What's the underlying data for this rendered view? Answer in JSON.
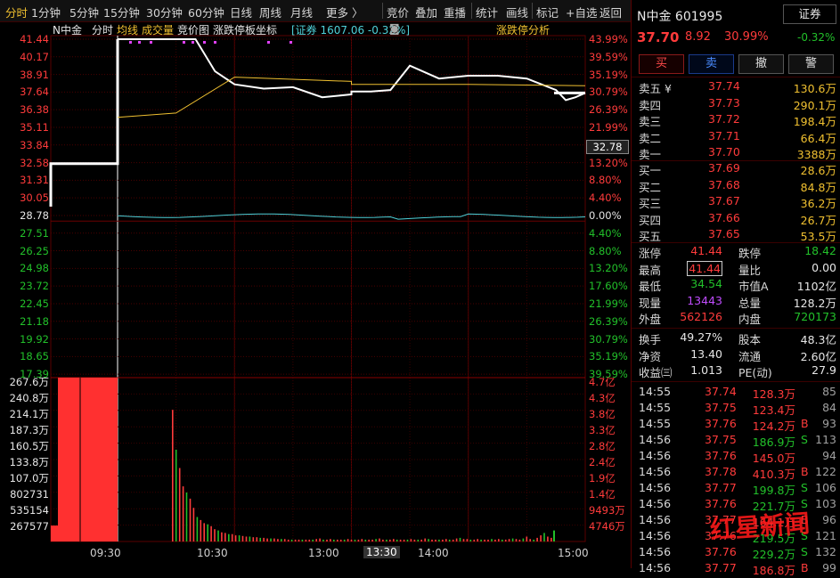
{
  "toolbar": {
    "items": [
      "分时",
      "1分钟",
      "5分钟",
      "15分钟",
      "30分钟",
      "60分钟",
      "日线",
      "周线",
      "月线",
      "更多 〉",
      "竞价",
      "叠加",
      "重播",
      "统计",
      "画线",
      "标记",
      "+自选",
      "返回"
    ]
  },
  "infobar": {
    "name": "N中金",
    "mode": "分时",
    "avg_label": "均线",
    "vol_label": "成交量",
    "auction_label": "竞价图",
    "limit_label": "涨跌停板坐标",
    "index_text": "[证券 1607.06 -0.32%]",
    "analysis_label": "涨跌停分析"
  },
  "price_axis": {
    "left": [
      "41.44",
      "40.17",
      "38.91",
      "37.64",
      "36.38",
      "35.11",
      "33.84",
      "32.58",
      "31.31",
      "30.05",
      "28.78",
      "27.51",
      "26.25",
      "24.98",
      "23.72",
      "22.45",
      "21.18",
      "19.92",
      "18.65",
      "17.39"
    ],
    "right": [
      "43.99%",
      "39.59%",
      "35.19%",
      "30.79%",
      "26.39%",
      "21.99%",
      "17.59%",
      "13.20%",
      "8.80%",
      "4.40%",
      "0.00%",
      "4.40%",
      "8.80%",
      "13.20%",
      "17.60%",
      "21.99%",
      "26.39%",
      "30.79%",
      "35.19%",
      "39.59%"
    ],
    "cursor_price": "32.78"
  },
  "volume_axis": {
    "left": [
      "267.6万",
      "240.8万",
      "214.1万",
      "187.3万",
      "160.5万",
      "133.8万",
      "107.0万",
      "802731",
      "535154",
      "267577"
    ],
    "right": [
      "4.7亿",
      "4.3亿",
      "3.8亿",
      "3.3亿",
      "2.8亿",
      "2.4亿",
      "1.9亿",
      "1.4亿",
      "9493万",
      "4746万"
    ]
  },
  "time_axis": [
    "09:30",
    "10:30",
    "13:00",
    "13:30",
    "14:00",
    "15:00"
  ],
  "chart_data": {
    "type": "line",
    "title": "",
    "xlabel": "",
    "ylabel": "",
    "prev_close": 28.78,
    "ylim": [
      17.39,
      41.44
    ],
    "auction_price": 32.78,
    "series": [
      {
        "x": [
          "09:30",
          "09:31",
          "09:35",
          "09:40",
          "09:45",
          "09:50",
          "09:55",
          "10:00",
          "10:10",
          "10:20",
          "10:30",
          "10:45",
          "11:00",
          "11:15",
          "11:30",
          "13:00",
          "13:10",
          "13:20",
          "13:30",
          "13:45",
          "14:00",
          "14:15",
          "14:30",
          "14:45",
          "14:50",
          "14:55",
          "15:00"
        ],
        "values": [
          41.44,
          41.44,
          41.44,
          41.44,
          41.44,
          41.44,
          41.44,
          41.44,
          41.44,
          39.2,
          38.3,
          38.0,
          38.1,
          37.4,
          37.6,
          37.8,
          37.8,
          37.9,
          39.6,
          38.7,
          38.9,
          38.9,
          38.7,
          37.9,
          37.2,
          37.4,
          37.7
        ]
      },
      {
        "x": [
          "09:30",
          "10:00",
          "10:30",
          "11:30",
          "13:00",
          "14:00",
          "15:00"
        ],
        "values": [
          36.0,
          36.3,
          38.8,
          38.5,
          38.3,
          38.3,
          38.2
        ]
      }
    ],
    "volume": {
      "unit": "万",
      "ylim": [
        0,
        267.6
      ],
      "auction": [
        26.0,
        267.6,
        267.6,
        80.0,
        60.0
      ],
      "bars": [
        215,
        150,
        120,
        90,
        80,
        70,
        55,
        40,
        35,
        30,
        28,
        25,
        20,
        18,
        15,
        14,
        12,
        12,
        10,
        10,
        9,
        8,
        8,
        7,
        7,
        6,
        6,
        5,
        5,
        5,
        4,
        4,
        4,
        3,
        3,
        3,
        3,
        3,
        3,
        3,
        3,
        4,
        5,
        3,
        3,
        4,
        3,
        3,
        3,
        3,
        4,
        3,
        3,
        3,
        4,
        3,
        3,
        3,
        4,
        5,
        3,
        3,
        3,
        4,
        3,
        3,
        3,
        3,
        4,
        3,
        3,
        3,
        5,
        4,
        3,
        3,
        3,
        3,
        4,
        3,
        3,
        5,
        6,
        4,
        4,
        3,
        3,
        4,
        3,
        3,
        3,
        4,
        3,
        4,
        3,
        3,
        4,
        5,
        4,
        3,
        5,
        8,
        4,
        3,
        6,
        10,
        14,
        8,
        6
      ]
    }
  },
  "panel": {
    "title": "N中金 601995",
    "badge": "证券",
    "badge_change": "-0.32%",
    "price": "37.70",
    "change": "8.92",
    "change_pct": "30.99%",
    "buttons": [
      "买",
      "卖",
      "撤",
      "警"
    ],
    "asks": [
      {
        "label": "卖五 ¥",
        "price": "37.74",
        "vol": "130.6万"
      },
      {
        "label": "卖四",
        "price": "37.73",
        "vol": "290.1万"
      },
      {
        "label": "卖三",
        "price": "37.72",
        "vol": "198.4万"
      },
      {
        "label": "卖二",
        "price": "37.71",
        "vol": "66.4万"
      },
      {
        "label": "卖一",
        "price": "37.70",
        "vol": "3388万"
      }
    ],
    "bids": [
      {
        "label": "买一",
        "price": "37.69",
        "vol": "28.6万"
      },
      {
        "label": "买二",
        "price": "37.68",
        "vol": "84.8万"
      },
      {
        "label": "买三",
        "price": "37.67",
        "vol": "36.2万"
      },
      {
        "label": "买四",
        "price": "37.66",
        "vol": "26.7万"
      },
      {
        "label": "买五",
        "price": "37.65",
        "vol": "53.5万"
      }
    ],
    "stats1": [
      {
        "k1": "涨停",
        "v1": "41.44",
        "k2": "跌停",
        "v2": "18.42"
      },
      {
        "k1": "最高",
        "v1": "41.44",
        "k2": "量比",
        "v2": "0.00"
      },
      {
        "k1": "最低",
        "v1": "34.54",
        "k2": "市值A",
        "v2": "1102亿"
      },
      {
        "k1": "现量",
        "v1": "13443",
        "k2": "总量",
        "v2": "128.2万"
      },
      {
        "k1": "外盘",
        "v1": "562126",
        "k2": "内盘",
        "v2": "720173"
      }
    ],
    "stats2": [
      {
        "k1": "换手",
        "v1": "49.27%",
        "k2": "股本",
        "v2": "48.3亿"
      },
      {
        "k1": "净资",
        "v1": "13.40",
        "k2": "流通",
        "v2": "2.60亿"
      },
      {
        "k1": "收益㈢",
        "v1": "1.013",
        "k2": "PE(动)",
        "v2": "27.9"
      }
    ],
    "ticks": [
      {
        "time": "14:55",
        "price": "37.74",
        "vol": "128.3万",
        "side": "",
        "count": "85"
      },
      {
        "time": "14:55",
        "price": "37.75",
        "vol": "123.4万",
        "side": "",
        "count": "84"
      },
      {
        "time": "14:55",
        "price": "37.76",
        "vol": "124.2万",
        "side": "B",
        "count": "93"
      },
      {
        "time": "14:56",
        "price": "37.75",
        "vol": "186.9万",
        "side": "S",
        "count": "113"
      },
      {
        "time": "14:56",
        "price": "37.76",
        "vol": "145.0万",
        "side": "",
        "count": "94"
      },
      {
        "time": "14:56",
        "price": "37.78",
        "vol": "410.3万",
        "side": "B",
        "count": "122"
      },
      {
        "time": "14:56",
        "price": "37.77",
        "vol": "199.8万",
        "side": "S",
        "count": "106"
      },
      {
        "time": "14:56",
        "price": "37.76",
        "vol": "221.7万",
        "side": "S",
        "count": "103"
      },
      {
        "time": "14:56",
        "price": "37.77",
        "vol": "164.1万",
        "side": "B",
        "count": "96"
      },
      {
        "time": "14:56",
        "price": "37.76",
        "vol": "219.5万",
        "side": "S",
        "count": "121"
      },
      {
        "time": "14:56",
        "price": "37.76",
        "vol": "229.2万",
        "side": "S",
        "count": "132"
      },
      {
        "time": "14:56",
        "price": "37.77",
        "vol": "186.8万",
        "side": "B",
        "count": "99"
      }
    ]
  },
  "watermark": "红星新闻",
  "colors": {
    "up": "#ff3b3b",
    "down": "#22c02a",
    "price_line": "#ffffff",
    "avg_line": "#f0c030",
    "grid": "#5a0000"
  }
}
